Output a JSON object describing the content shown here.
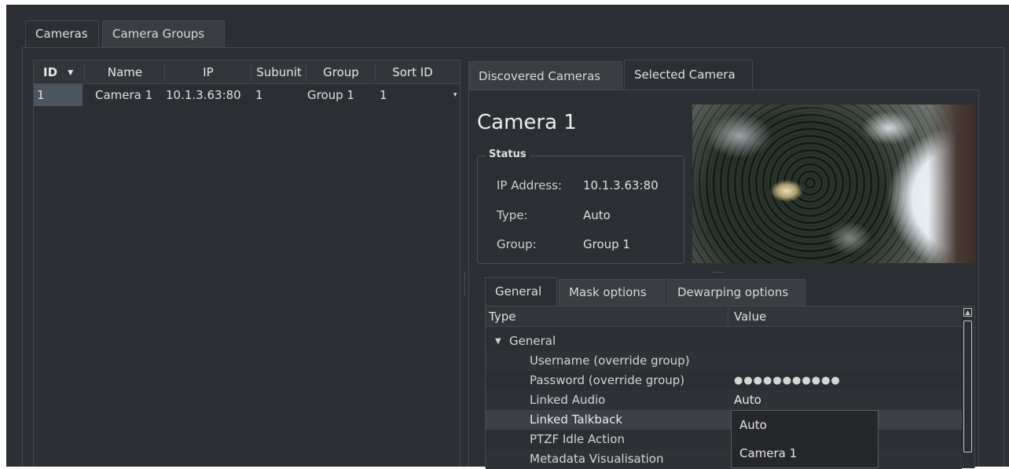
{
  "top_tabs": [
    "Cameras",
    "Camera Groups"
  ],
  "table": {
    "columns": [
      "ID",
      "Name",
      "IP",
      "Subunit",
      "Group",
      "Sort ID"
    ],
    "rows": [
      {
        "id": "1",
        "name": "Camera 1",
        "ip": "10.1.3.63:80",
        "subunit": "1",
        "group": "Group 1",
        "sort_id": "1"
      }
    ]
  },
  "right_tabs": [
    "Discovered Cameras",
    "Selected Camera"
  ],
  "camera": {
    "title": "Camera 1",
    "status_label": "Status",
    "ip_label": "IP Address:",
    "ip_value": "10.1.3.63:80",
    "type_label": "Type:",
    "type_value": "Auto",
    "group_label": "Group:",
    "group_value": "Group 1"
  },
  "options_tabs": [
    "General",
    "Mask options",
    "Dewarping options"
  ],
  "properties": {
    "col_type": "Type",
    "col_value": "Value",
    "group_name": "General",
    "rows": [
      {
        "label": "Username (override group)",
        "value": ""
      },
      {
        "label": "Password (override group)",
        "value": "●●●●●●●●●●●"
      },
      {
        "label": "Linked Audio",
        "value": "Auto"
      },
      {
        "label": "Linked Talkback",
        "value": ""
      },
      {
        "label": "PTZF Idle Action",
        "value": ""
      },
      {
        "label": "Metadata Visualisation",
        "value": ""
      }
    ]
  },
  "dropdown_options": [
    "Auto",
    "Camera 1"
  ],
  "colors": {
    "selected_cell": "#4a5560",
    "panel_bg": "#2b2e33",
    "highlight_row": "#3d4046"
  }
}
